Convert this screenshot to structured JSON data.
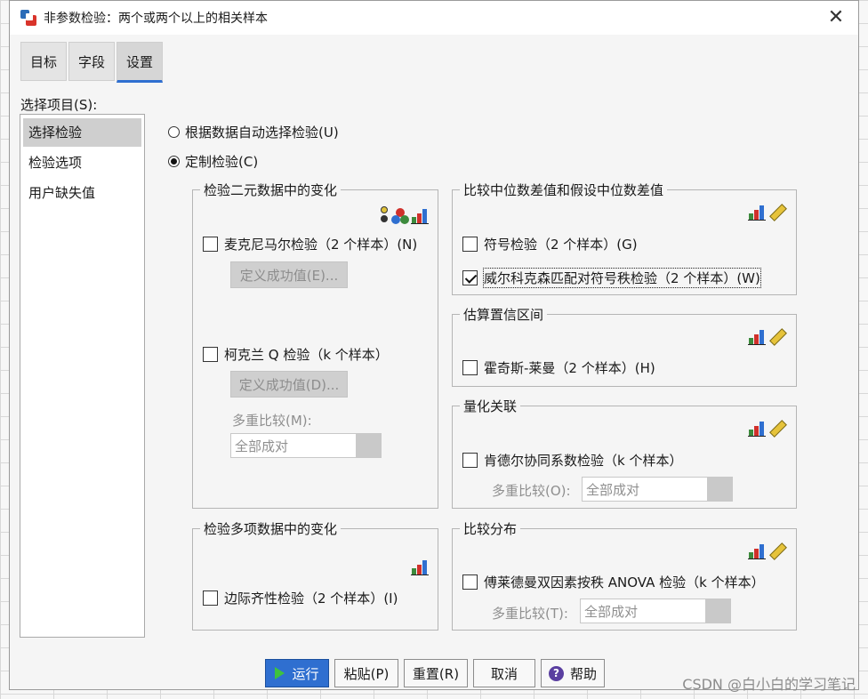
{
  "window": {
    "title": "非参数检验：两个或两个以上的相关样本",
    "close_glyph": "✕"
  },
  "tabs": [
    {
      "label": "目标"
    },
    {
      "label": "字段"
    },
    {
      "label": "设置",
      "active": true
    }
  ],
  "sidebar": {
    "header": "选择项目(S):",
    "items": [
      {
        "label": "选择检验",
        "selected": true
      },
      {
        "label": "检验选项"
      },
      {
        "label": "用户缺失值"
      }
    ]
  },
  "mode": {
    "auto_label": "根据数据自动选择检验(U)",
    "custom_label": "定制检验(C)",
    "selected": "custom"
  },
  "binary_group": {
    "title": "检验二元数据中的变化",
    "mcnemar_label": "麦克尼马尔检验（2 个样本）(N)",
    "mcnemar_checked": false,
    "mcnemar_define": "定义成功值(E)...",
    "cochran_label": "柯克兰 Q 检验（k 个样本）",
    "cochran_checked": false,
    "cochran_define": "定义成功值(D)...",
    "multiple_label": "多重比较(M):",
    "multiple_value": "全部成对"
  },
  "multinomial_group": {
    "title": "检验多项数据中的变化",
    "marginal_label": "边际齐性检验（2 个样本）(I)",
    "marginal_checked": false
  },
  "median_group": {
    "title": "比较中位数差值和假设中位数差值",
    "sign_label": "符号检验（2 个样本）(G)",
    "sign_checked": false,
    "wilcoxon_label": "威尔科克森匹配对符号秩检验（2 个样本）(W)",
    "wilcoxon_checked": true
  },
  "ci_group": {
    "title": "估算置信区间",
    "hodges_label": "霍奇斯-莱曼（2 个样本）(H)",
    "hodges_checked": false
  },
  "assoc_group": {
    "title": "量化关联",
    "kendall_label": "肯德尔协同系数检验（k 个样本）",
    "kendall_checked": false,
    "multiple_label": "多重比较(O):",
    "multiple_value": "全部成对"
  },
  "dist_group": {
    "title": "比较分布",
    "friedman_label": "傅莱德曼双因素按秩 ANOVA 检验（k 个样本）",
    "friedman_checked": false,
    "multiple_label": "多重比较(T):",
    "multiple_value": "全部成对"
  },
  "buttons": {
    "run": "运行",
    "paste": "粘贴(P)",
    "reset": "重置(R)",
    "cancel": "取消",
    "help": "帮助"
  },
  "watermark": "CSDN @白小白的学习笔记",
  "colors": {
    "accent": "#2f6fd0",
    "run_button": "#2f6fd0"
  }
}
